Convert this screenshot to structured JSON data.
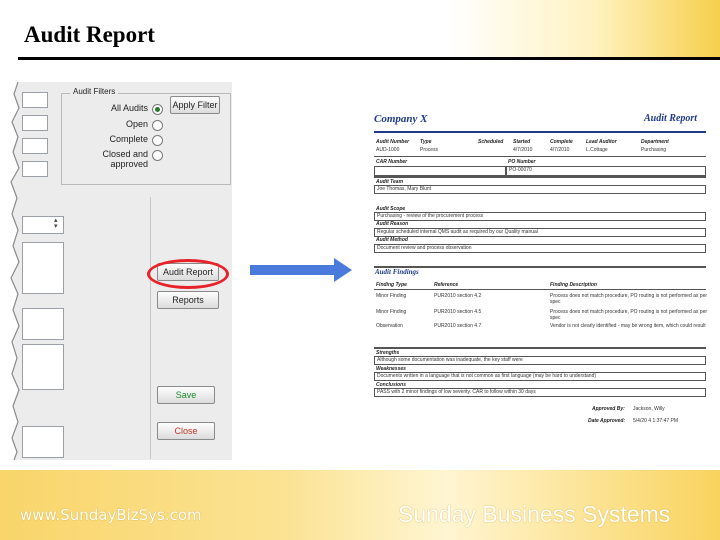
{
  "slide": {
    "title": "Audit Report",
    "footer_url": "www.SundayBizSys.com",
    "footer_company": "Sunday Business Systems"
  },
  "dialog": {
    "group_label": "Audit Filters",
    "radio_options": [
      {
        "label": "All Audits",
        "selected": true
      },
      {
        "label": "Open",
        "selected": false
      },
      {
        "label": "Complete",
        "selected": false
      },
      {
        "label": "Closed and approved",
        "selected": false
      }
    ],
    "apply_filter_label": "Apply Filter",
    "audit_report_label": "Audit Report",
    "reports_label": "Reports",
    "save_label": "Save",
    "close_label": "Close",
    "highlight_color": "#e8222a"
  },
  "report": {
    "company": "Company X",
    "title": "Audit Report",
    "columns": [
      "Audit Number",
      "Type",
      "Scheduled",
      "Started",
      "Complete",
      "Lead Auditor",
      "Department"
    ],
    "values": [
      "AUD-1000",
      "Process",
      "",
      "4/7/2010",
      "4/7/2010",
      "L.Cottage",
      "Purchasing"
    ],
    "car_label": "CAR Number",
    "po_label": "PO Number",
    "po_value": "PO-00070",
    "sections": [
      {
        "heading": "Audit Team",
        "text": "Joe Thomas, Mary Blunt"
      },
      {
        "heading": "Audit Scope",
        "text": "Purchasing - review of the procurement process"
      },
      {
        "heading": "Audit Reason",
        "text": "Regular scheduled internal QMS audit as required by our Quality manual"
      },
      {
        "heading": "Audit Method",
        "text": "Document review and process observation"
      }
    ],
    "findings_heading": "Audit Findings",
    "findings_columns": [
      "Finding Type",
      "Reference",
      "Finding Description"
    ],
    "findings": [
      {
        "type": "Minor Finding",
        "reference": "PUR2010 section 4.2",
        "description": "Process does not match procedure, PO routing is not performed as per spec"
      },
      {
        "type": "Minor Finding",
        "reference": "PUR2010 section 4.5",
        "description": "Process does not match procedure, PO routing is not performed as per spec"
      },
      {
        "type": "Observation",
        "reference": "PUR2010 section 4.7",
        "description": "Vendor is not clearly identified - may be wrong item, which could result"
      }
    ],
    "strengths_heading": "Strengths",
    "strengths_text": "Although some documentation was inadequate, the key staff were",
    "weaknesses_heading": "Weaknesses",
    "weaknesses_text": "Documents written in a language that is not common as first language (may be hard to understand)",
    "conclusions_heading": "Conclusions",
    "conclusions_text": "PASS with 2 minor findings of low severity. CAR to follow within 30 days",
    "approved_by_label": "Approved By:",
    "approved_by_value": "Jackson, Willy",
    "approved_date_label": "Date Approved:",
    "approved_date_value": "5/4/20 4 1:37:47 PM"
  },
  "colors": {
    "arrow": "#4a7bdc",
    "footer_gold": "#f9d56a",
    "report_heading": "#1f3b8a"
  }
}
